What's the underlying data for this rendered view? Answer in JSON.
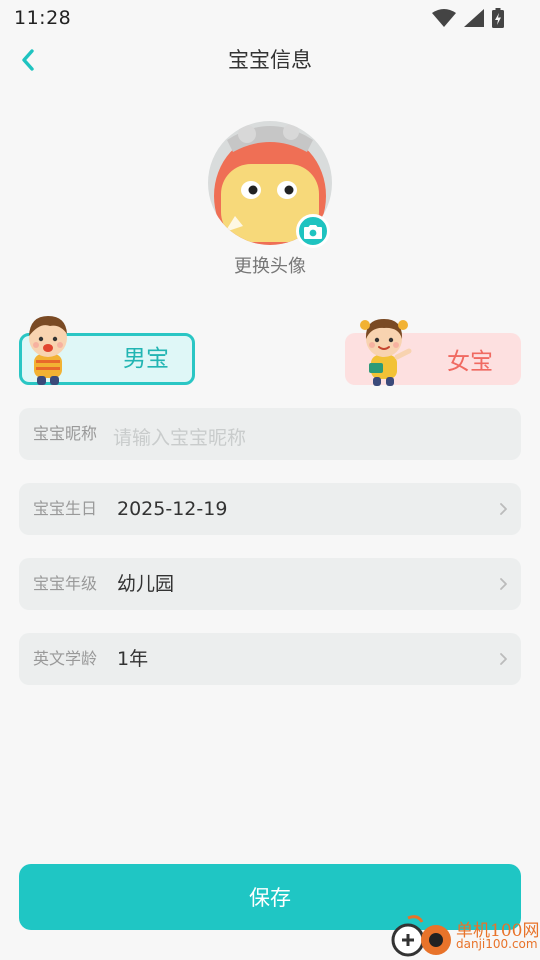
{
  "status_bar": {
    "time": "11:28",
    "icons": [
      "wifi-icon",
      "signal-icon",
      "battery-charging-icon"
    ]
  },
  "nav": {
    "back_icon": "chevron-left-icon",
    "title": "宝宝信息"
  },
  "avatar": {
    "change_label": "更换头像",
    "camera_icon": "camera-icon"
  },
  "gender": {
    "boy_label": "男宝",
    "girl_label": "女宝",
    "selected": "boy"
  },
  "form": {
    "nickname": {
      "label": "宝宝昵称",
      "value": "",
      "placeholder": "请输入宝宝昵称"
    },
    "birthday": {
      "label": "宝宝生日",
      "value": "2025-12-19"
    },
    "grade": {
      "label": "宝宝年级",
      "value": "幼儿园"
    },
    "english_age": {
      "label": "英文学龄",
      "value": "1年"
    }
  },
  "save_button": {
    "label": "保存"
  },
  "watermark": {
    "line1": "单机100网",
    "line2": "danji100.com"
  },
  "colors": {
    "accent": "#1fc6c4",
    "boy_bg": "#dff7f7",
    "girl_bg": "#fde0e0",
    "girl_text": "#f06a61",
    "field_bg": "#eceeee",
    "page_bg": "#f7f7f7"
  }
}
